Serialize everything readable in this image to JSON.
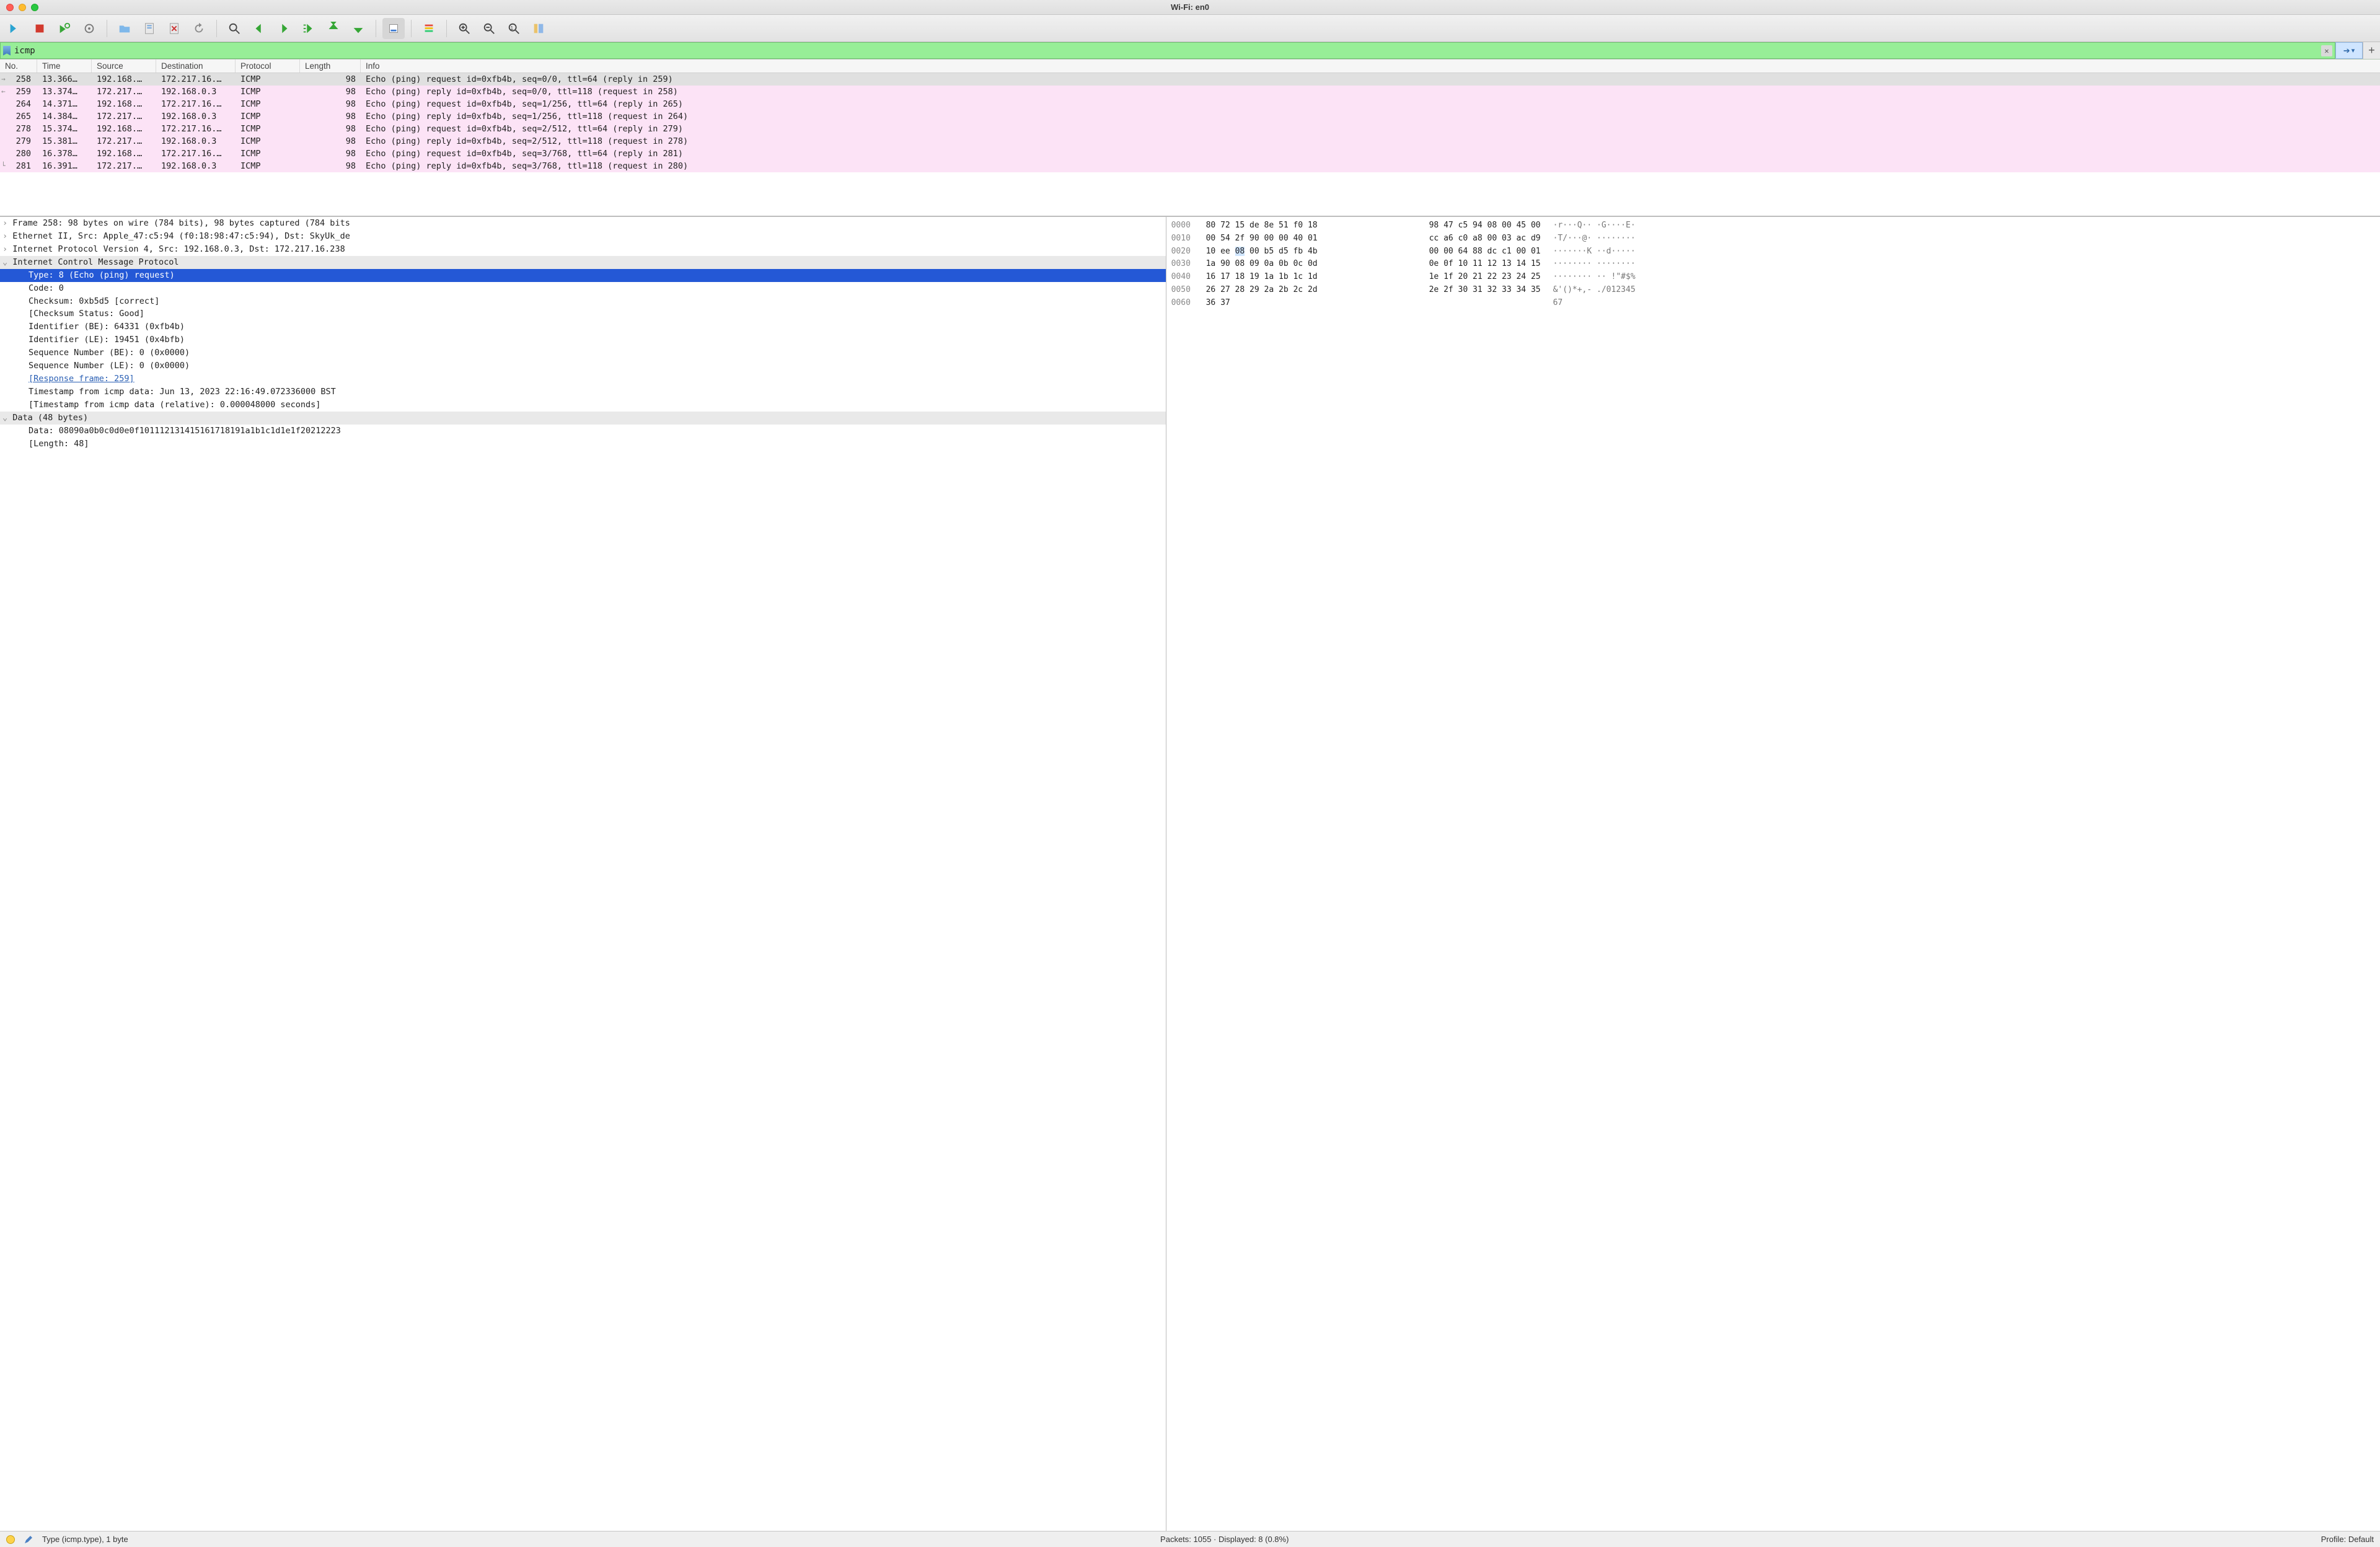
{
  "window": {
    "title": "Wi-Fi: en0"
  },
  "filter": {
    "value": "icmp"
  },
  "columns": [
    "No.",
    "Time",
    "Source",
    "Destination",
    "Protocol",
    "Length",
    "Info"
  ],
  "packets": [
    {
      "no": "258",
      "time": "13.366…",
      "src": "192.168.…",
      "dst": "172.217.16.…",
      "proto": "ICMP",
      "len": "98",
      "info": "Echo (ping) request  id=0xfb4b, seq=0/0, ttl=64 (reply in 259)",
      "mark": "→",
      "sel": true
    },
    {
      "no": "259",
      "time": "13.374…",
      "src": "172.217.…",
      "dst": "192.168.0.3",
      "proto": "ICMP",
      "len": "98",
      "info": "Echo (ping) reply    id=0xfb4b, seq=0/0, ttl=118 (request in 258)",
      "mark": "←"
    },
    {
      "no": "264",
      "time": "14.371…",
      "src": "192.168.…",
      "dst": "172.217.16.…",
      "proto": "ICMP",
      "len": "98",
      "info": "Echo (ping) request  id=0xfb4b, seq=1/256, ttl=64 (reply in 265)"
    },
    {
      "no": "265",
      "time": "14.384…",
      "src": "172.217.…",
      "dst": "192.168.0.3",
      "proto": "ICMP",
      "len": "98",
      "info": "Echo (ping) reply    id=0xfb4b, seq=1/256, ttl=118 (request in 264)"
    },
    {
      "no": "278",
      "time": "15.374…",
      "src": "192.168.…",
      "dst": "172.217.16.…",
      "proto": "ICMP",
      "len": "98",
      "info": "Echo (ping) request  id=0xfb4b, seq=2/512, ttl=64 (reply in 279)"
    },
    {
      "no": "279",
      "time": "15.381…",
      "src": "172.217.…",
      "dst": "192.168.0.3",
      "proto": "ICMP",
      "len": "98",
      "info": "Echo (ping) reply    id=0xfb4b, seq=2/512, ttl=118 (request in 278)"
    },
    {
      "no": "280",
      "time": "16.378…",
      "src": "192.168.…",
      "dst": "172.217.16.…",
      "proto": "ICMP",
      "len": "98",
      "info": "Echo (ping) request  id=0xfb4b, seq=3/768, ttl=64 (reply in 281)"
    },
    {
      "no": "281",
      "time": "16.391…",
      "src": "172.217.…",
      "dst": "192.168.0.3",
      "proto": "ICMP",
      "len": "98",
      "info": "Echo (ping) reply    id=0xfb4b, seq=3/768, ttl=118 (request in 280)",
      "mark": "└"
    }
  ],
  "details": {
    "frame": "Frame 258: 98 bytes on wire (784 bits), 98 bytes captured (784 bits",
    "eth": "Ethernet II, Src: Apple_47:c5:94 (f0:18:98:47:c5:94), Dst: SkyUk_de",
    "ip": "Internet Protocol Version 4, Src: 192.168.0.3, Dst: 172.217.16.238",
    "icmp": "Internet Control Message Protocol",
    "type": "Type: 8 (Echo (ping) request)",
    "code": "Code: 0",
    "cksum": "Checksum: 0xb5d5 [correct]",
    "ckstat": "[Checksum Status: Good]",
    "idbe": "Identifier (BE): 64331 (0xfb4b)",
    "idle": "Identifier (LE): 19451 (0x4bfb)",
    "seqbe": "Sequence Number (BE): 0 (0x0000)",
    "seqle": "Sequence Number (LE): 0 (0x0000)",
    "resp": "[Response frame: 259]",
    "ts": "Timestamp from icmp data: Jun 13, 2023 22:16:49.072336000 BST",
    "tsrel": "[Timestamp from icmp data (relative): 0.000048000 seconds]",
    "datahdr": "Data (48 bytes)",
    "data": "Data: 08090a0b0c0d0e0f101112131415161718191a1b1c1d1e1f20212223",
    "dlen": "[Length: 48]"
  },
  "hex": [
    {
      "off": "0000",
      "a": "80 72 15 de 8e 51 f0 18",
      "b": "98 47 c5 94 08 00 45 00",
      "asc": "·r···Q·· ·G····E·"
    },
    {
      "off": "0010",
      "a": "00 54 2f 90 00 00 40 01",
      "b": "cc a6 c0 a8 00 03 ac d9",
      "asc": "·T/···@· ········"
    },
    {
      "off": "0020",
      "a": "10 ee 08 00 b5 d5 fb 4b",
      "b": "00 00 64 88 dc c1 00 01",
      "asc": "··[·]····K ··d·····",
      "hl": 2
    },
    {
      "off": "0030",
      "a": "1a 90 08 09 0a 0b 0c 0d",
      "b": "0e 0f 10 11 12 13 14 15",
      "asc": "········ ········"
    },
    {
      "off": "0040",
      "a": "16 17 18 19 1a 1b 1c 1d",
      "b": "1e 1f 20 21 22 23 24 25",
      "asc": "········ ·· !\"#$%"
    },
    {
      "off": "0050",
      "a": "26 27 28 29 2a 2b 2c 2d",
      "b": "2e 2f 30 31 32 33 34 35",
      "asc": "&'()*+,- ./012345"
    },
    {
      "off": "0060",
      "a": "36 37",
      "b": "",
      "asc": "67"
    }
  ],
  "status": {
    "left": "Type (icmp.type), 1 byte",
    "mid": "Packets: 1055 · Displayed: 8 (0.8%)",
    "right": "Profile: Default"
  }
}
